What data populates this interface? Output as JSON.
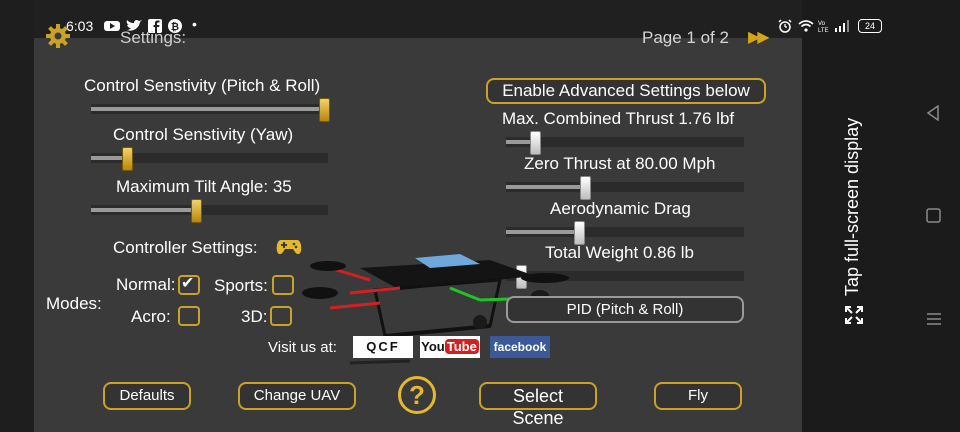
{
  "status_bar": {
    "time": "6:03",
    "dot": "•",
    "battery": "24",
    "icons_left": [
      "youtube-icon",
      "twitter-icon",
      "facebook-icon",
      "bitcoin-icon"
    ],
    "icons_right": [
      "alarm-icon",
      "wifi-icon",
      "volte-icon",
      "signal-icon",
      "battery-icon"
    ]
  },
  "header": {
    "settings_label": "Settings:",
    "page_indicator": "Page 1 of 2",
    "next_label": "▶▶"
  },
  "left_sliders": [
    {
      "label": "Control Senstivity (Pitch & Roll)",
      "value": 1.0
    },
    {
      "label": "Control Senstivity (Yaw)",
      "value": 0.15
    },
    {
      "label": "Maximum Tilt Angle: 35",
      "value": 0.44
    }
  ],
  "advanced_button": "Enable Advanced Settings below",
  "right_sliders": [
    {
      "label": "Max. Combined Thrust 1.76 lbf",
      "value": 0.12
    },
    {
      "label": "Zero Thrust at 80.00 Mph",
      "value": 0.33
    },
    {
      "label": "Aerodynamic Drag",
      "value": 0.31
    },
    {
      "label": "Total Weight 0.86 lb",
      "value": 0.06
    }
  ],
  "controller": {
    "label": "Controller Settings:",
    "modes_label": "Modes:",
    "modes": [
      {
        "label": "Normal:",
        "checked": true
      },
      {
        "label": "Sports:",
        "checked": false
      },
      {
        "label": "Acro:",
        "checked": false
      },
      {
        "label": "3D:",
        "checked": false
      }
    ]
  },
  "pid_button": "PID (Pitch & Roll)",
  "visit": {
    "label": "Visit us at:",
    "qcf": "QCF",
    "youtube_you": "You",
    "youtube_tube": "Tube",
    "facebook": "facebook"
  },
  "bottom_buttons": {
    "defaults": "Defaults",
    "change_uav": "Change UAV",
    "help": "?",
    "select_scene": "Select Scene",
    "fly": "Fly"
  },
  "side": {
    "fullscreen_text": "Tap full-screen display"
  },
  "colors": {
    "gold": "#c9a227",
    "panel": "#3a3a3a",
    "arm_red": "#d42020",
    "arm_green": "#22c322"
  }
}
